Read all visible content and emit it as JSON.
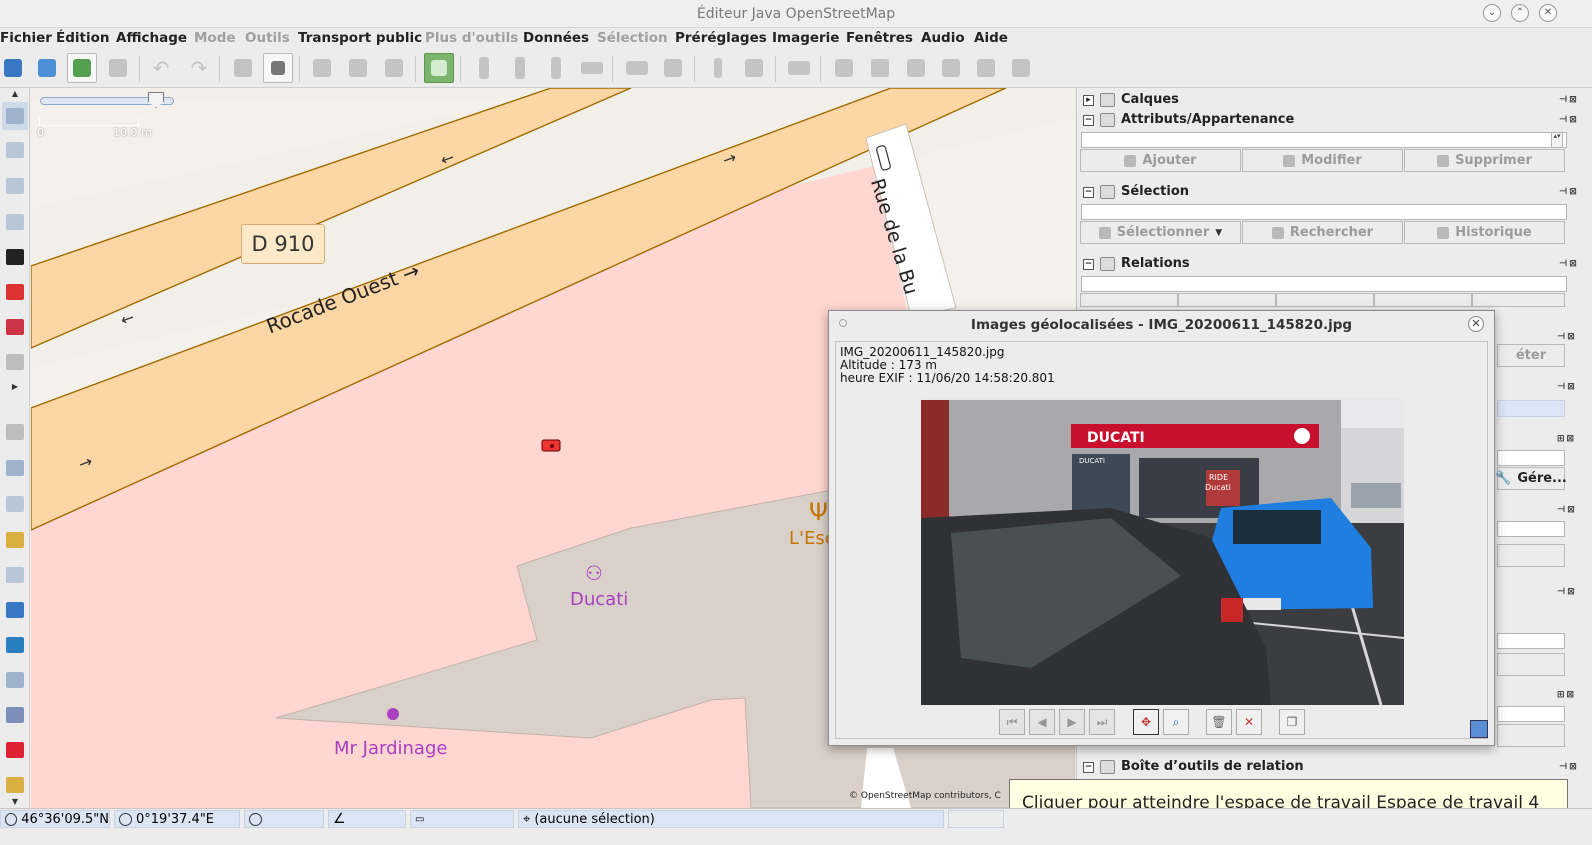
{
  "window": {
    "title": "Éditeur Java OpenStreetMap",
    "controls": [
      "chevron-down",
      "chevron-up",
      "close"
    ]
  },
  "menu": {
    "items": [
      "Fichier",
      "Édition",
      "Affichage",
      "Mode",
      "Outils",
      "Transport public",
      "Plus d'outils",
      "Données",
      "Sélection",
      "Préréglages",
      "Imagerie",
      "Fenêtres",
      "Audio",
      "Aide"
    ]
  },
  "map": {
    "scale_label_start": "0",
    "scale_label_end": "10.0 m",
    "road_ref": "D 910",
    "road_name": "Rocade Ouest",
    "road_direction_mark": "→",
    "street_name": "Rue de la Bu",
    "poi_ducati": "Ducati",
    "poi_jardinage": "Mr Jardinage",
    "poi_restaurant": "L'Esc",
    "attribution": "© OpenStreetMap contributors, C",
    "colors": {
      "landuse_retail": "#ffd6d1",
      "building": "#d9d0c9",
      "primary_road": "#fcd6a4",
      "road_casing": "#a06b00",
      "path_ground": "#f2efe9"
    }
  },
  "panels": {
    "calques": "Calques",
    "attributs": "Attributs/Appartenance",
    "ajouter": "Ajouter",
    "modifier": "Modifier",
    "supprimer": "Supprimer",
    "selection": "Sélection",
    "selectionner": "Sélectionner",
    "rechercher": "Rechercher",
    "historique": "Historique",
    "relations": "Relations",
    "partial_feter": "éter",
    "partial_gere": "Gére...",
    "boite_outils": "Boîte d’outils de relation"
  },
  "dialog": {
    "title": "Images géolocalisées - IMG_20200611_145820.jpg",
    "filename": "IMG_20200611_145820.jpg",
    "altitude": "Altitude : 173 m",
    "exif_time": "heure EXIF : 11/06/20 14:58:20.801",
    "sign_ducati": "DUCATI",
    "sign_ducati_small": "DUCATI",
    "sign_ride": "RIDE",
    "sign_ducati_window": "Ducati"
  },
  "tooltip": "Cliquer pour atteindre l'espace de travail Espace de travail 4",
  "status": {
    "latitude": "46°36'09.5\"N",
    "longitude": "0°19'37.4\"E",
    "selection": "(aucune sélection)"
  }
}
